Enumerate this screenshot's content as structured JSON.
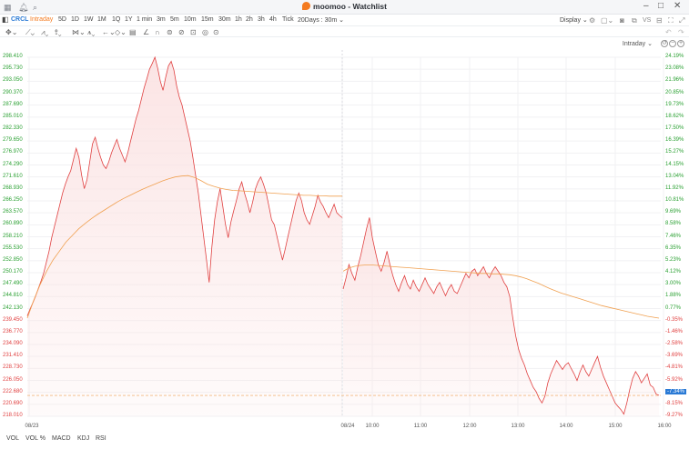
{
  "titlebar": {
    "app_name": "moomoo - Watchlist"
  },
  "toolbar": {
    "symbol": "CRCL",
    "periods": [
      "Intraday",
      "5D",
      "1D",
      "1W",
      "1M",
      "1Q",
      "1Y",
      "1 min",
      "3m",
      "5m",
      "10m",
      "15m",
      "30m",
      "1h",
      "2h",
      "3h",
      "4h",
      "Tick",
      "20Days : 30m"
    ],
    "active_period": "Intraday",
    "display_label": "Display"
  },
  "chart_header": {
    "mode_label": "Intraday"
  },
  "colors": {
    "price_line": "#e04040",
    "price_fill": "#fbe3e3",
    "avg_line": "#f0a050",
    "up": "#2aa032",
    "down": "#e04040",
    "ref_line": "#f0a050",
    "current_badge": "#2a7ad5"
  },
  "chart_data": {
    "type": "line",
    "title": "",
    "left_axis_ticks": [
      "298.410",
      "295.730",
      "293.050",
      "290.370",
      "287.690",
      "285.010",
      "282.330",
      "279.650",
      "276.970",
      "274.290",
      "271.610",
      "268.930",
      "266.250",
      "263.570",
      "260.890",
      "258.210",
      "255.530",
      "252.850",
      "250.170",
      "247.490",
      "244.810",
      "242.130",
      "239.450",
      "236.770",
      "234.090",
      "231.410",
      "228.730",
      "226.050",
      "222.680",
      "220.690",
      "218.010"
    ],
    "right_axis_ticks": [
      "24.19%",
      "23.08%",
      "21.96%",
      "20.85%",
      "19.73%",
      "18.62%",
      "17.50%",
      "16.39%",
      "15.27%",
      "14.15%",
      "13.04%",
      "11.92%",
      "10.81%",
      "9.69%",
      "8.58%",
      "7.46%",
      "6.35%",
      "5.23%",
      "4.12%",
      "3.00%",
      "1.88%",
      "0.77%",
      "-0.35%",
      "-1.46%",
      "-2.58%",
      "-3.69%",
      "-4.81%",
      "-5.92%",
      "-7.34%",
      "-8.15%",
      "-9.27%"
    ],
    "ref_price": 240.26,
    "current_price": 222.68,
    "current_change": "-7.34%",
    "ylim": [
      218.01,
      298.41
    ],
    "x_labels": [
      "08/23",
      "08/24",
      "10:00",
      "11:00",
      "12:00",
      "13:00",
      "14:00",
      "15:00",
      "16:00"
    ],
    "day1": {
      "price": [
        240.5,
        242.0,
        243.4,
        244.8,
        246.5,
        248.2,
        250.0,
        252.5,
        255.0,
        258.0,
        260.5,
        263.0,
        265.5,
        268.0,
        270.0,
        271.6,
        273.0,
        275.5,
        278.0,
        276.0,
        272.0,
        269.0,
        271.0,
        275.0,
        279.0,
        280.5,
        278.0,
        276.0,
        274.3,
        273.5,
        275.0,
        277.0,
        278.5,
        280.0,
        278.0,
        276.5,
        275.0,
        277.0,
        279.5,
        282.0,
        284.5,
        286.5,
        289.0,
        291.5,
        293.5,
        295.7,
        297.0,
        298.4,
        296.0,
        293.0,
        291.0,
        294.0,
        296.5,
        297.5,
        295.5,
        292.0,
        289.5,
        287.7,
        285.0,
        282.3,
        279.6,
        276.0,
        272.0,
        268.0,
        263.0,
        258.0,
        253.0,
        248.0,
        256.0,
        262.0,
        266.0,
        269.0,
        265.0,
        261.0,
        258.0,
        261.5,
        264.0,
        266.3,
        268.9,
        270.5,
        268.0,
        266.0,
        263.6,
        266.0,
        268.9,
        270.5,
        271.6,
        270.0,
        268.0,
        265.0,
        262.0,
        260.9,
        258.2,
        255.5,
        253.0,
        255.5,
        258.2,
        260.9,
        263.6,
        266.3,
        268.0,
        266.3,
        263.6,
        262.0,
        261.0,
        263.0,
        265.0,
        267.5,
        266.0,
        265.0,
        263.6,
        262.5,
        264.0,
        265.5,
        263.6,
        263.0,
        262.5
      ],
      "avg": [
        240.0,
        244.0,
        247.5,
        250.5,
        253.0,
        255.0,
        257.0,
        258.5,
        260.0,
        261.2,
        262.3,
        263.3,
        264.2,
        265.1,
        266.0,
        266.8,
        267.5,
        268.2,
        268.9,
        269.5,
        270.1,
        270.7,
        271.2,
        271.6,
        271.8,
        271.9,
        271.5,
        270.8,
        270.0,
        269.5,
        269.1,
        268.8,
        268.6,
        268.5,
        268.4,
        268.3,
        268.2,
        268.1,
        268.0,
        267.9,
        267.8,
        267.7,
        267.6,
        267.5,
        267.5,
        267.4,
        267.4,
        267.3,
        267.3,
        267.3
      ]
    },
    "day2": {
      "price": [
        246.5,
        249.0,
        252.0,
        250.0,
        248.5,
        251.5,
        254.0,
        257.0,
        260.0,
        262.5,
        258.0,
        255.0,
        252.0,
        250.5,
        252.5,
        255.0,
        252.0,
        249.5,
        247.5,
        246.0,
        248.0,
        249.5,
        247.5,
        246.5,
        248.5,
        247.0,
        246.0,
        247.5,
        249.0,
        247.5,
        246.5,
        245.5,
        247.0,
        248.0,
        246.5,
        245.0,
        246.5,
        247.5,
        246.0,
        245.5,
        247.0,
        248.5,
        250.0,
        249.0,
        250.5,
        251.0,
        249.5,
        250.5,
        251.5,
        250.0,
        249.0,
        250.5,
        251.5,
        250.5,
        249.5,
        248.0,
        247.0,
        244.8,
        240.0,
        236.0,
        233.0,
        231.0,
        229.5,
        227.5,
        226.0,
        224.5,
        223.5,
        222.0,
        221.0,
        222.5,
        225.5,
        227.5,
        229.0,
        230.5,
        229.5,
        228.5,
        229.5,
        230.0,
        228.7,
        227.5,
        226.0,
        228.0,
        229.5,
        228.0,
        227.0,
        228.5,
        230.0,
        231.4,
        229.0,
        227.0,
        225.5,
        224.0,
        222.5,
        221.0,
        220.2,
        219.5,
        218.5,
        221.0,
        224.0,
        226.5,
        228.0,
        227.0,
        225.5,
        226.5,
        227.5,
        225.0,
        224.5,
        223.0,
        222.7
      ],
      "avg": [
        250.5,
        251.2,
        251.6,
        251.8,
        251.9,
        251.9,
        251.8,
        251.7,
        251.6,
        251.5,
        251.4,
        251.3,
        251.2,
        251.1,
        251.0,
        250.9,
        250.8,
        250.7,
        250.6,
        250.5,
        250.4,
        250.3,
        250.2,
        250.1,
        250.0,
        250.0,
        249.9,
        249.9,
        249.8,
        249.7,
        249.5,
        249.2,
        248.8,
        248.3,
        247.8,
        247.2,
        246.6,
        246.1,
        245.6,
        245.2,
        244.8,
        244.4,
        244.0,
        243.6,
        243.2,
        242.8,
        242.5,
        242.2,
        241.9,
        241.6,
        241.3,
        241.0,
        240.7,
        240.4,
        240.2,
        240.0
      ]
    }
  },
  "bottom_tabs": [
    "VOL",
    "VOL %",
    "MACD",
    "KDJ",
    "RSI"
  ]
}
